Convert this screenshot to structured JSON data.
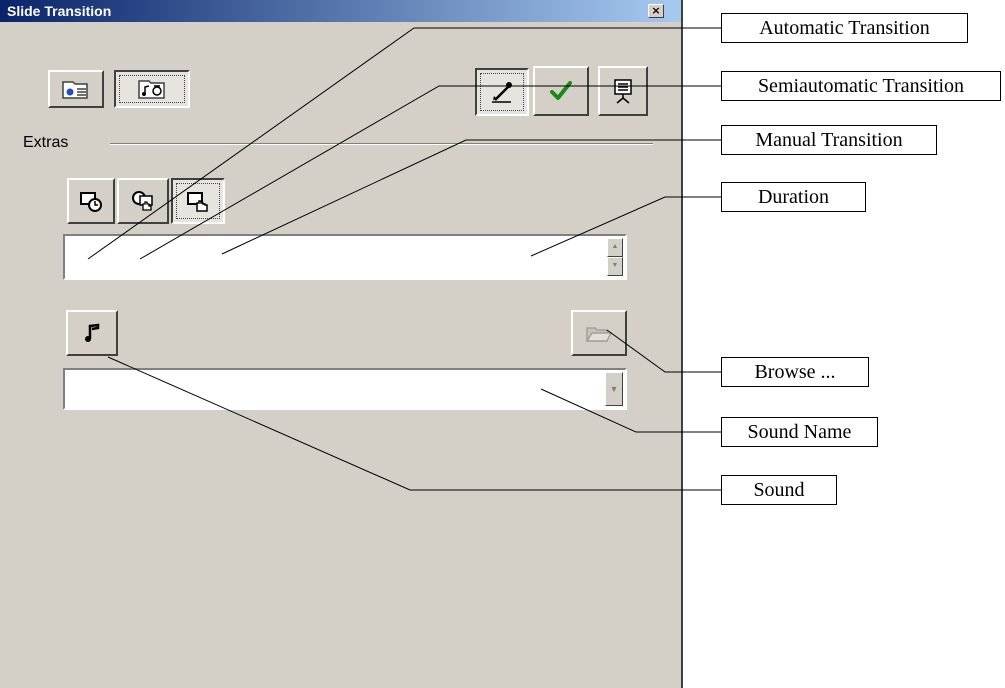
{
  "window": {
    "title": "Slide Transition",
    "close_glyph": "×"
  },
  "toolbar": {
    "left_icons": [
      "slide-transition-effect-icon",
      "slide-transition-sound-timing-icon"
    ],
    "right_icons": [
      "edit-icon",
      "apply-check-icon",
      "preview-presentation-icon"
    ]
  },
  "extras": {
    "label": "Extras",
    "transition_mode_icons": [
      "automatic-transition-icon",
      "semiautomatic-transition-icon",
      "manual-transition-icon"
    ],
    "duration_value": "",
    "sound_icon": "music-note-icon",
    "browse_icon": "open-folder-icon",
    "sound_name_value": ""
  },
  "callouts": {
    "automatic": "Automatic Transition",
    "semiautomatic": "Semiautomatic Transition",
    "manual": "Manual Transition",
    "duration": "Duration",
    "browse": "Browse ...",
    "sound_name": "Sound Name",
    "sound": "Sound"
  },
  "colors": {
    "face": "#d4d0c8",
    "titlebar_start": "#0a246a",
    "titlebar_end": "#a6caf0",
    "check_green": "#1a8a1a"
  }
}
